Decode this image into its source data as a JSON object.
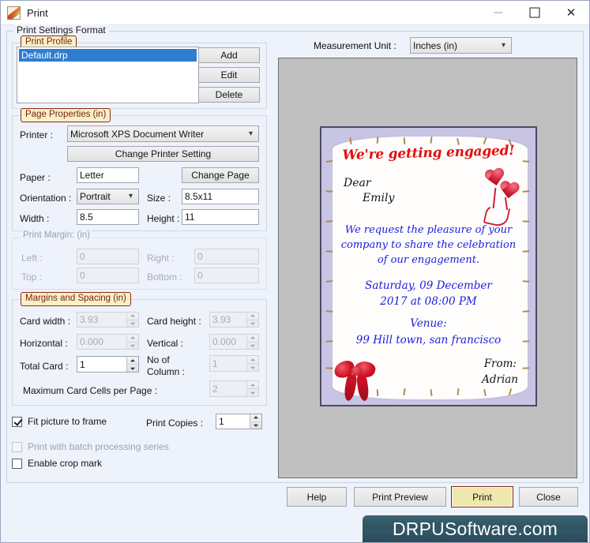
{
  "window": {
    "title": "Print",
    "icon": "paint-brush-icon",
    "minimize_label": "—",
    "maximize_label": "□",
    "close_label": "✕"
  },
  "print_settings_format": {
    "legend": "Print Settings Format"
  },
  "print_profile": {
    "legend": "Print Profile",
    "items": [
      "Default.drp"
    ],
    "selected": "Default.drp",
    "buttons": {
      "add": "Add",
      "edit": "Edit",
      "delete": "Delete"
    }
  },
  "page_properties": {
    "legend": "Page Properties  (in)",
    "printer_label": "Printer :",
    "printer_value": "Microsoft XPS Document Writer",
    "change_printer_setting": "Change Printer Setting",
    "paper_label": "Paper :",
    "paper_value": "Letter",
    "change_page": "Change Page",
    "orientation_label": "Orientation :",
    "orientation_value": "Portrait",
    "size_label": "Size :",
    "size_value": "8.5x11",
    "width_label": "Width :",
    "width_value": "8.5",
    "height_label": "Height :",
    "height_value": "11"
  },
  "print_margin": {
    "legend": "Print Margin: (in)",
    "left_label": "Left :",
    "left_value": "0",
    "right_label": "Right :",
    "right_value": "0",
    "top_label": "Top :",
    "top_value": "0",
    "bottom_label": "Bottom :",
    "bottom_value": "0"
  },
  "margins_spacing": {
    "legend": "Margins and Spacing  (in)",
    "card_width_label": "Card width :",
    "card_width_value": "3.93",
    "card_height_label": "Card height :",
    "card_height_value": "3.93",
    "horizontal_label": "Horizontal :",
    "horizontal_value": "0.000",
    "vertical_label": "Vertical :",
    "vertical_value": "0.000",
    "total_card_label": "Total Card :",
    "total_card_value": "1",
    "no_of_column_label_line1": "No of",
    "no_of_column_label_line2": "Column :",
    "no_of_column_value": "1",
    "max_cells_label": "Maximum Card Cells per Page :",
    "max_cells_value": "2"
  },
  "options": {
    "fit_picture_to_frame": "Fit picture to frame",
    "fit_picture_checked": true,
    "print_batch": "Print with batch processing series",
    "print_batch_checked": false,
    "enable_crop_mark": "Enable crop mark",
    "enable_crop_checked": false,
    "print_copies_label": "Print Copies :",
    "print_copies_value": "1"
  },
  "measurement": {
    "label": "Measurement Unit :",
    "value": "Inches (in)"
  },
  "card_preview": {
    "title": "We're getting engaged!",
    "dear": "Dear",
    "recipient": "Emily",
    "request_line1": "We request the pleasure of your",
    "request_line2": "company to share the celebration",
    "request_line3": "of our engagement.",
    "date_line1": "Saturday, 09 December",
    "date_line2": "2017 at 08:00 PM",
    "venue_label": "Venue:",
    "venue_address": "99 Hill town, san francisco",
    "from_label": "From:",
    "from_name": "Adrian"
  },
  "footer": {
    "help": "Help",
    "print_preview": "Print Preview",
    "print": "Print",
    "close": "Close"
  },
  "watermark": {
    "text": "DRPUSoftware.com"
  },
  "colors": {
    "accent_legend_bg": "#f7f0c8",
    "accent_legend_border": "#8f2b16",
    "primary_button_bg": "#eee7ae",
    "selection_blue": "#2f7dd1",
    "card_red": "#e01010",
    "card_blue": "#1b1ce0",
    "watermark_bg": "#2d5260"
  }
}
